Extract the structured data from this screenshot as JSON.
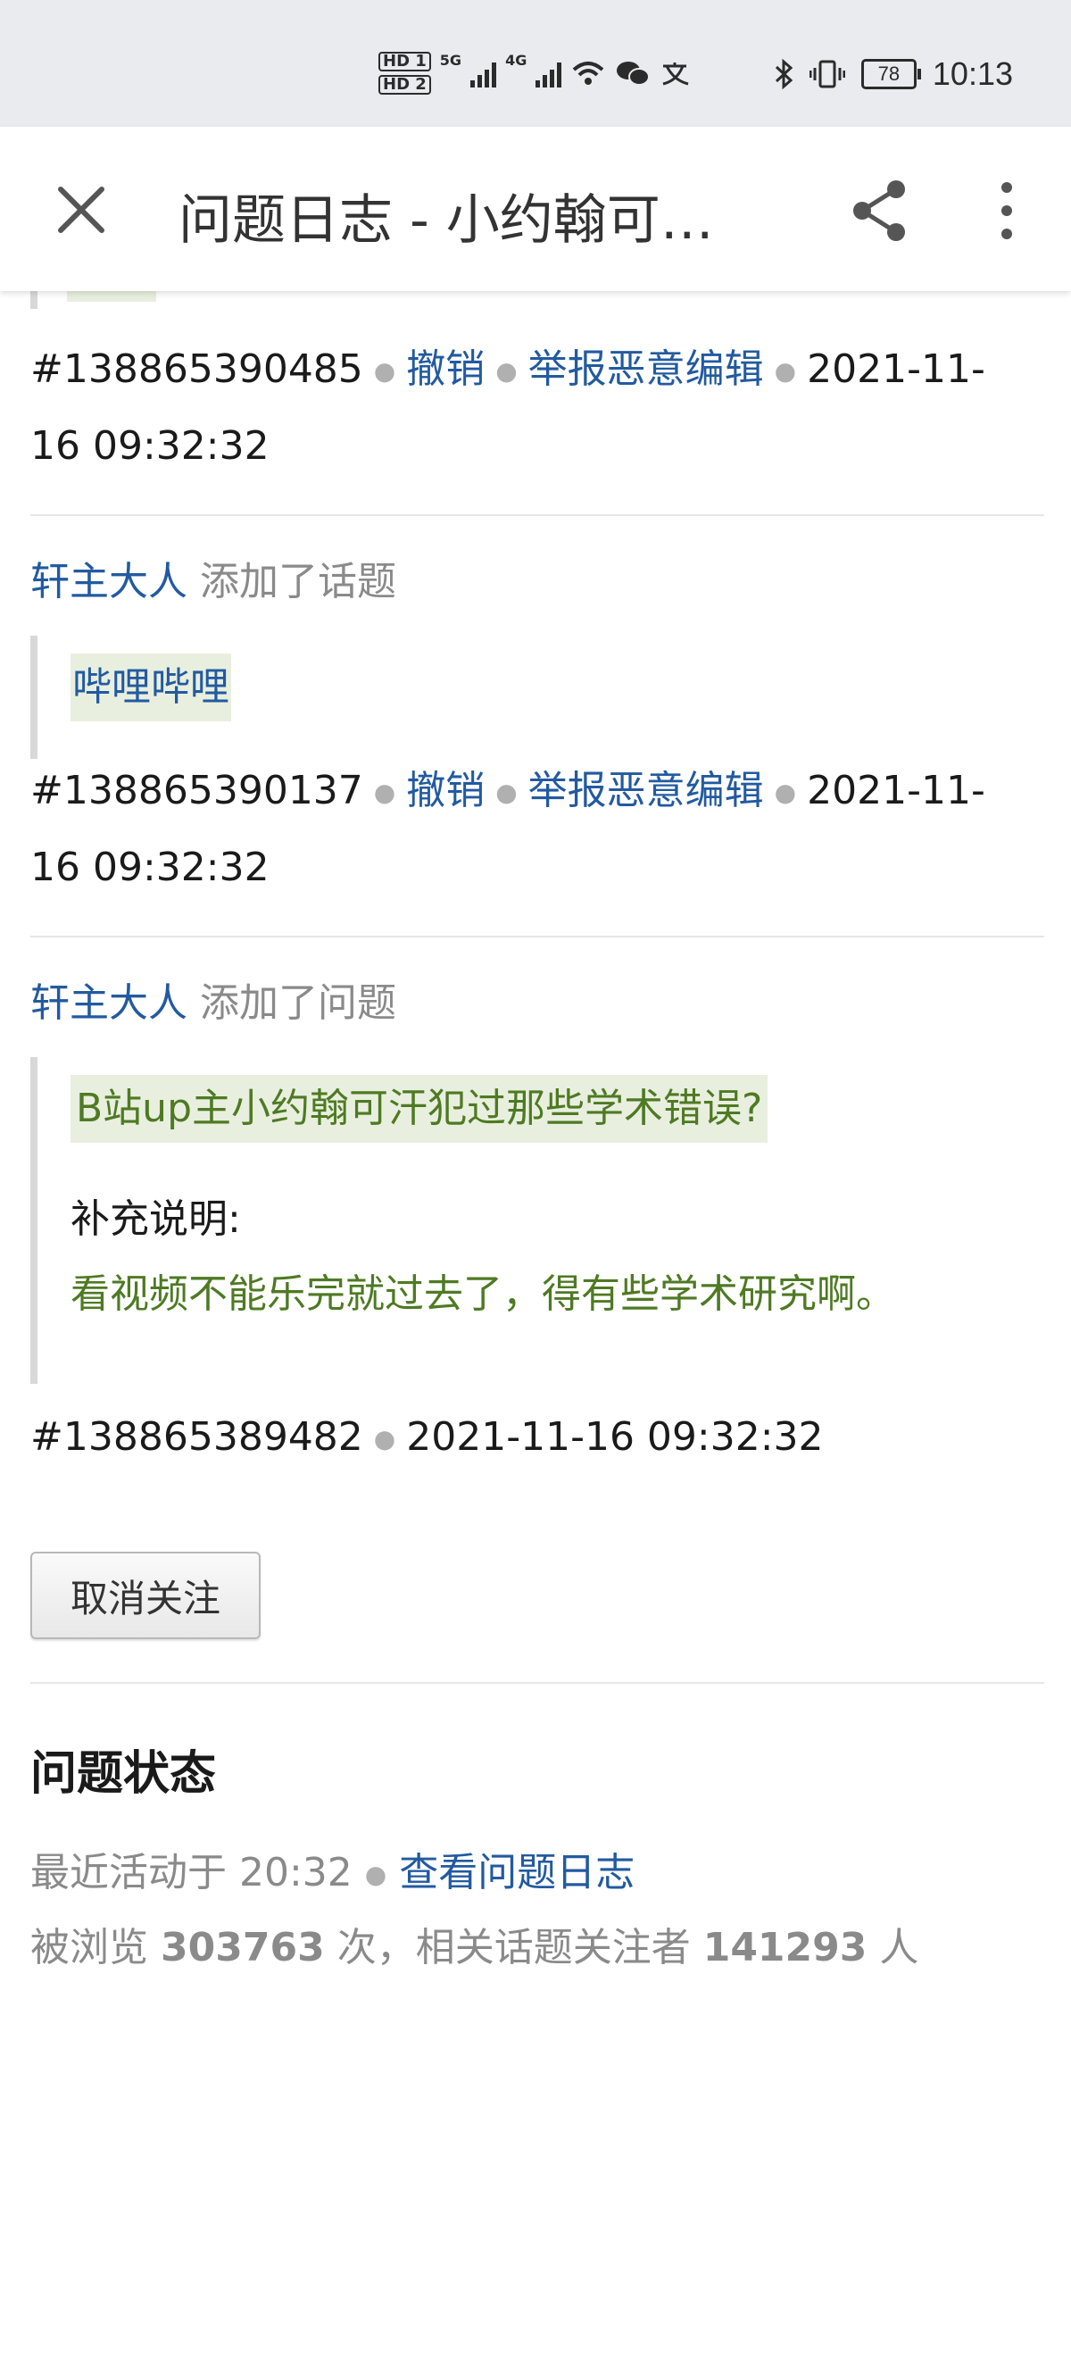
{
  "status_bar": {
    "hd1": "HD 1",
    "hd2": "HD 2",
    "net1": "5G",
    "net2": "4G",
    "battery": "78",
    "time": "10:13",
    "icons": [
      "wifi-icon",
      "wechat-icon",
      "translate-icon",
      "bluetooth-icon",
      "vibrate-icon"
    ]
  },
  "app_bar": {
    "title": "问题日志 - 小约翰可…",
    "icons": [
      "close-icon",
      "share-icon",
      "more-vert-icon"
    ]
  },
  "entries": [
    {
      "id": "#138865390485",
      "undo": "撤销",
      "report": "举报恶意编辑",
      "time_part1": "2021-11-",
      "time_part2": "16 09:32:32"
    },
    {
      "author": "轩主大人",
      "action": "添加了话题",
      "topic": "哔哩哔哩",
      "id": "#138865390137",
      "undo": "撤销",
      "report": "举报恶意编辑",
      "time_part1": "2021-11-",
      "time_part2": "16 09:32:32"
    },
    {
      "author": "轩主大人",
      "action": "添加了问题",
      "question": "B站up主小约翰可汗犯过那些学术错误?",
      "supp_label": "补充说明:",
      "supp_text": "看视频不能乐完就过去了，得有些学术研究啊。",
      "id": "#138865389482",
      "time": "2021-11-16 09:32:32"
    }
  ],
  "unfollow_label": "取消关注",
  "question_status": {
    "title": "问题状态",
    "recent_label": "最近活动于 20:32",
    "log_link": "查看问题日志",
    "views_prefix": "被浏览",
    "views": "303763",
    "views_suffix": "次，相关话题关注者",
    "followers": "141293",
    "followers_suffix": "人"
  }
}
